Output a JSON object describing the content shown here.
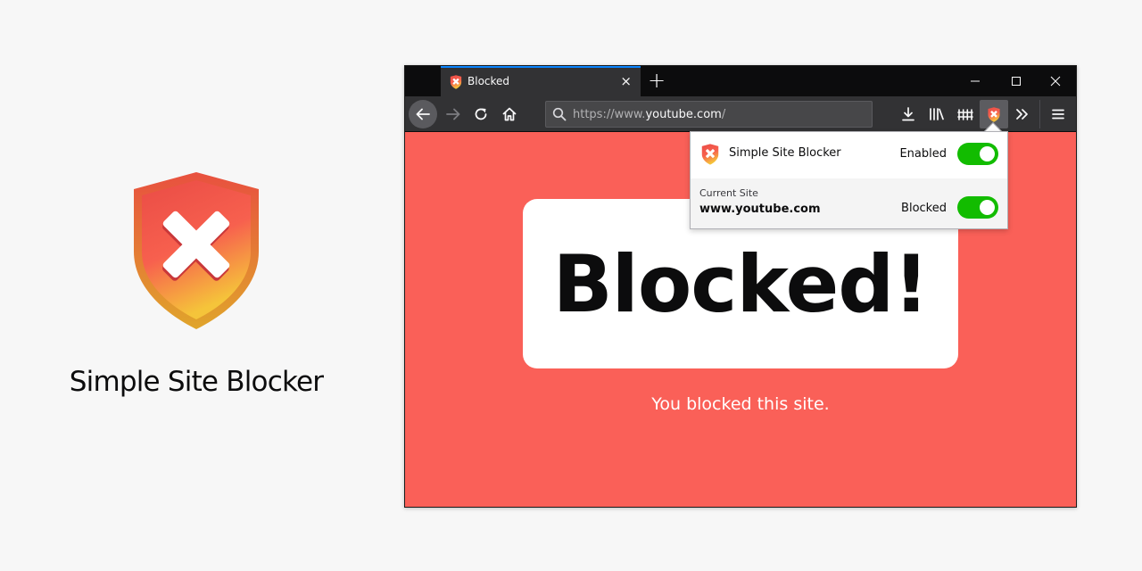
{
  "brand": {
    "title": "Simple Site Blocker"
  },
  "browser": {
    "tab": {
      "title": "Blocked",
      "close_icon": "×"
    },
    "new_tab_icon": "+",
    "window_controls": {
      "minimize": "minimize-icon",
      "maximize": "maximize-icon",
      "close": "close-icon"
    },
    "toolbar": {
      "back": "back-arrow-icon",
      "forward": "forward-arrow-icon",
      "reload": "reload-icon",
      "home": "home-icon",
      "downloads": "download-icon",
      "library": "library-icon",
      "extension_2": "fence-icon",
      "extension_active": "shield-icon",
      "overflow": "overflow-chevron-icon",
      "menu": "hamburger-icon"
    },
    "url": {
      "prefix": "https://www.",
      "host": "youtube.com",
      "suffix": "/"
    }
  },
  "page": {
    "heading": "Blocked!",
    "subtitle": "You blocked this site."
  },
  "popup": {
    "name": "Simple Site Blocker",
    "enabled_label": "Enabled",
    "enabled": true,
    "current_site_label": "Current Site",
    "current_site": "www.youtube.com",
    "blocked_label": "Blocked",
    "blocked": true
  },
  "colors": {
    "page_background": "#fa6058",
    "toggle_on": "#12bc00",
    "tab_accent": "#0a84ff",
    "shield_red": "#ea5448",
    "shield_yellow": "#f5c23a"
  }
}
